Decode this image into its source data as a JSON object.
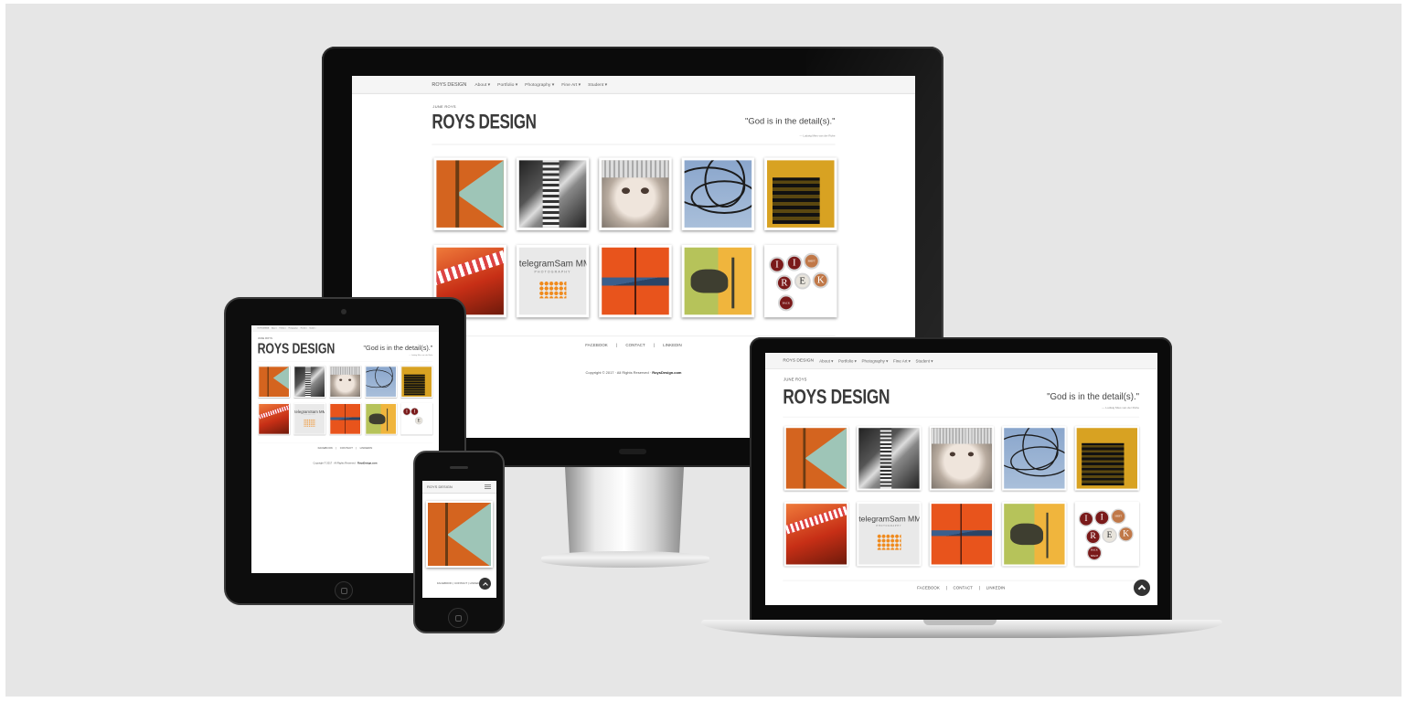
{
  "site": {
    "nav": {
      "brand": "ROYS DESIGN",
      "items": [
        "About ▾",
        "Portfolio ▾",
        "Photography ▾",
        "Fine Art ▾",
        "Student ▾"
      ]
    },
    "header": {
      "tagline": "JUNE ROYS",
      "title": "ROYS DESIGN",
      "quote": "\"God is in the detail(s).\"",
      "cite": "— Ludwig Mies van der Rohe"
    },
    "tiles": [
      {
        "art": "orange-teal-geometric"
      },
      {
        "art": "sculpture-bw"
      },
      {
        "art": "baby-portrait"
      },
      {
        "art": "power-lines"
      },
      {
        "art": "fire-escape"
      },
      {
        "art": "red-film-strip"
      },
      {
        "art": "telegramsam-logo",
        "text": "telegramSam MM",
        "sub": "PHOTOGRAPHY"
      },
      {
        "art": "orange-chevron"
      },
      {
        "art": "cow-illustration"
      },
      {
        "art": "typewriter-keys",
        "keys": [
          "I",
          "SHIFT LOCK",
          "I",
          "R",
          "E",
          "K",
          "BACK SPACE"
        ]
      }
    ],
    "footer": {
      "links": [
        "FACEBOOK",
        "CONTACT",
        "LINKEDIN"
      ],
      "separator": "|",
      "copyright_prefix": "Copyright © 2017 · All Rights Reserved · ",
      "copyright_brand": "RoysDesign.com"
    },
    "phone": {
      "brand": "ROYS DESIGN",
      "menu_icon": "hamburger-icon",
      "footer_links": "FACEBOOK | CONTACT | LINKEDIN"
    },
    "scroll_top_icon": "chevron-up-icon"
  },
  "colors": {
    "backdrop": "#e6e6e6",
    "device_black": "#0b0b0b",
    "accent_orange": "#f08a1c",
    "nav_bg": "#f5f5f5"
  }
}
